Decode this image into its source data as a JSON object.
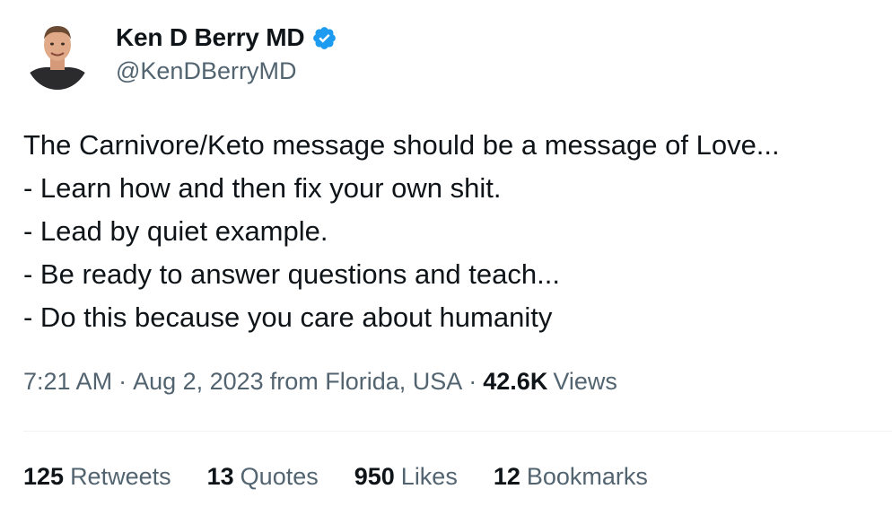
{
  "author": {
    "name": "Ken D Berry MD",
    "handle": "@KenDBerryMD",
    "verified_icon": "verified-badge-icon",
    "badge_color": "#1d9bf0"
  },
  "tweet": {
    "lines": [
      "The Carnivore/Keto message should be a message of Love...",
      "- Learn how and then fix your own shit.",
      "- Lead by quiet example.",
      "- Be ready to answer questions and teach...",
      "- Do this because you care about humanity"
    ]
  },
  "meta": {
    "time": "7:21 AM",
    "separator": "·",
    "date": "Aug 2, 2023",
    "location": "from Florida, USA",
    "views_count": "42.6K",
    "views_label": "Views"
  },
  "stats": {
    "retweets": {
      "count": "125",
      "label": "Retweets"
    },
    "quotes": {
      "count": "13",
      "label": "Quotes"
    },
    "likes": {
      "count": "950",
      "label": "Likes"
    },
    "bookmarks": {
      "count": "12",
      "label": "Bookmarks"
    }
  },
  "colors": {
    "text_primary": "#0f1419",
    "text_secondary": "#536471",
    "divider": "#eff3f4"
  }
}
